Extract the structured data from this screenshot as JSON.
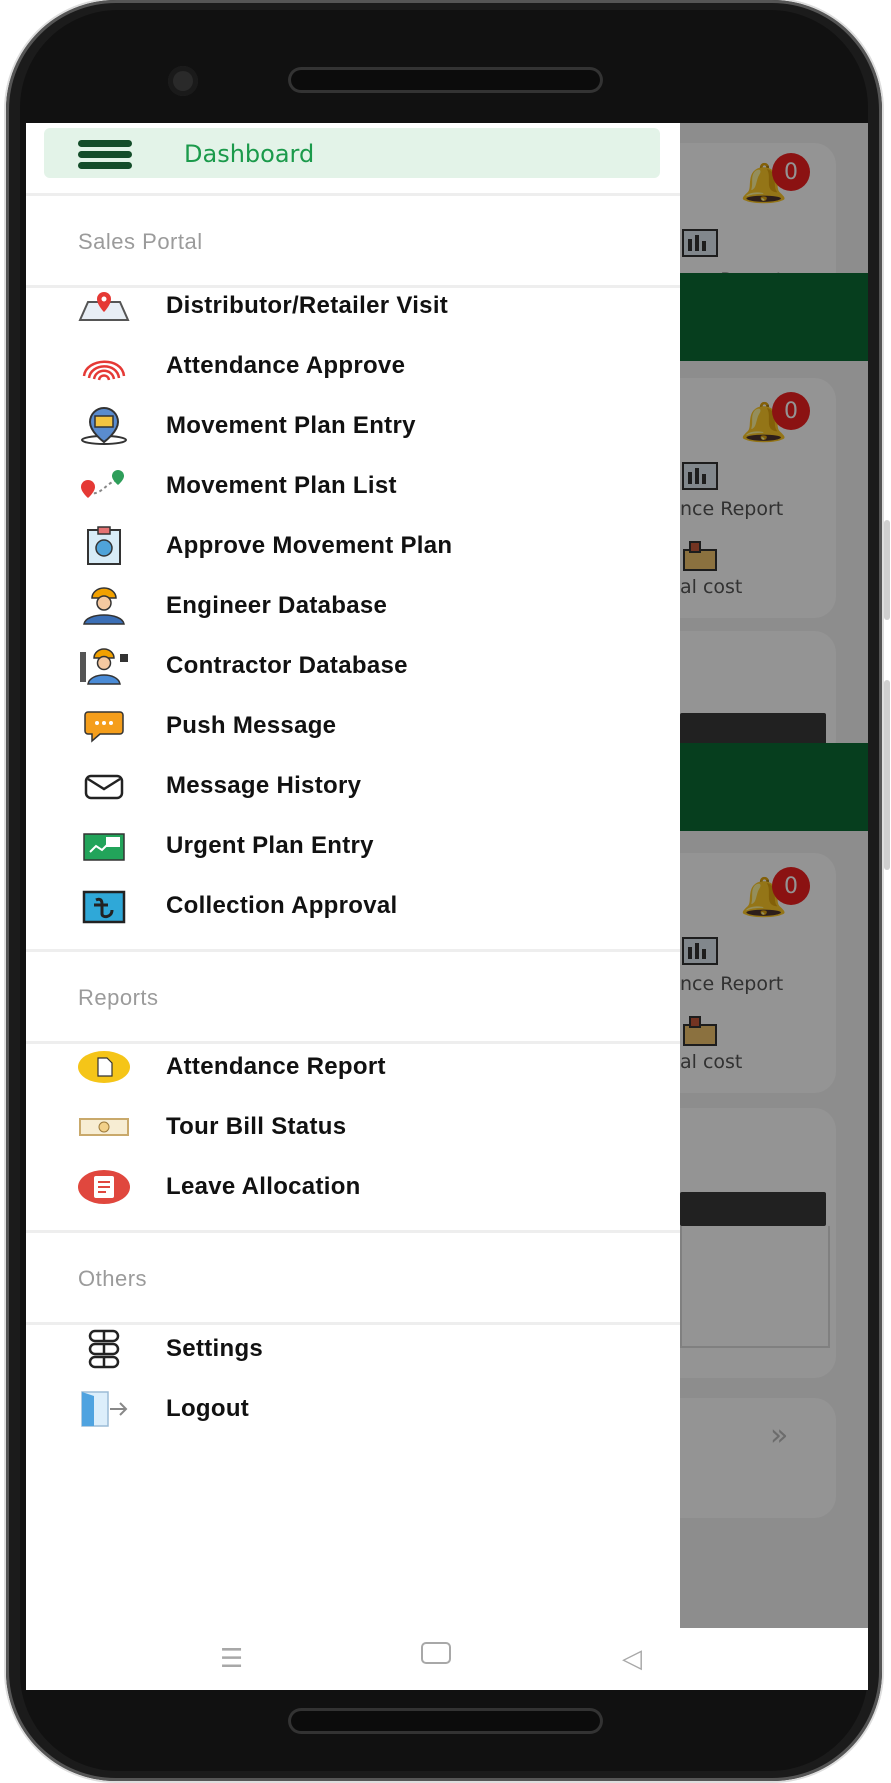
{
  "drawer": {
    "dashboard_label": "Dashboard",
    "sections": {
      "sales": "Sales Portal",
      "reports": "Reports",
      "others": "Others"
    },
    "sales_items": [
      {
        "label": "Distributor/Retailer Visit",
        "icon": "map-pin-icon"
      },
      {
        "label": "Attendance Approve",
        "icon": "fingerprint-icon"
      },
      {
        "label": "Movement Plan Entry",
        "icon": "location-screen-icon"
      },
      {
        "label": "Movement Plan List",
        "icon": "route-icon"
      },
      {
        "label": "Approve Movement Plan",
        "icon": "clipboard-icon"
      },
      {
        "label": "Engineer Database",
        "icon": "engineer-icon"
      },
      {
        "label": "Contractor Database",
        "icon": "contractor-icon"
      },
      {
        "label": "Push Message",
        "icon": "chat-bubble-icon"
      },
      {
        "label": "Message History",
        "icon": "envelope-icon"
      },
      {
        "label": "Urgent Plan Entry",
        "icon": "urgent-plan-icon"
      },
      {
        "label": "Collection Approval",
        "icon": "taka-icon"
      }
    ],
    "report_items": [
      {
        "label": "Attendance Report",
        "icon": "report-icon"
      },
      {
        "label": "Tour Bill Status",
        "icon": "bill-icon"
      },
      {
        "label": "Leave Allocation",
        "icon": "leave-icon"
      }
    ],
    "other_items": [
      {
        "label": "Settings",
        "icon": "settings-icon"
      },
      {
        "label": "Logout",
        "icon": "logout-icon"
      }
    ]
  },
  "background": {
    "badge_count": "0",
    "report_label": "nce Report",
    "cost_label": "al cost"
  },
  "colors": {
    "accent_green": "#1b9a4b",
    "drawer_highlight": "#e3f3e8",
    "band_green": "#0b6b35",
    "badge_red": "#ef1f1f"
  }
}
